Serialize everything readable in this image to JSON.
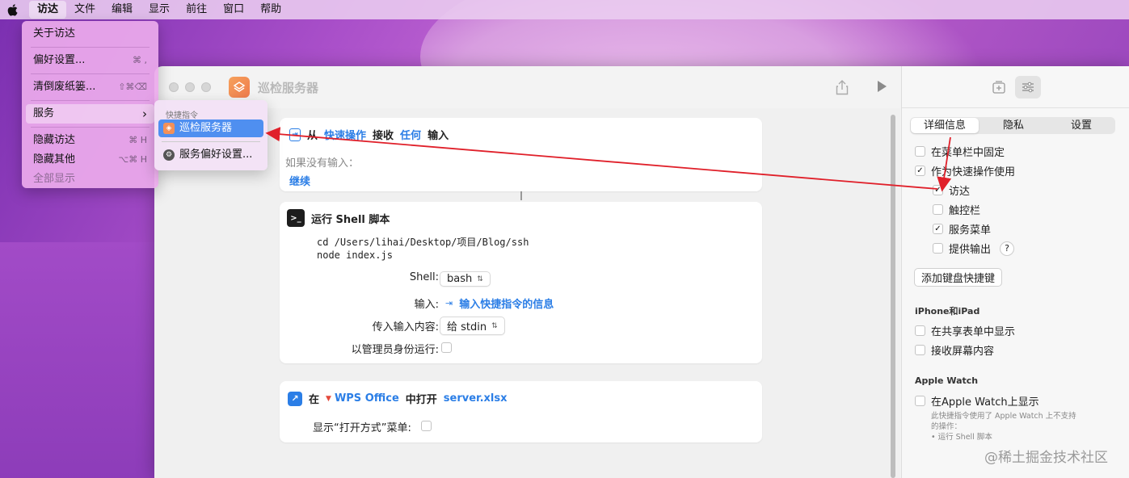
{
  "menubar": {
    "apple_icon": "apple-icon",
    "items": [
      "访达",
      "文件",
      "编辑",
      "显示",
      "前往",
      "窗口",
      "帮助"
    ],
    "active_index": 0
  },
  "finder_menu": {
    "about": "关于访达",
    "preferences": "偏好设置...",
    "preferences_shortcut": "⌘ ,",
    "empty_trash": "清倒废纸篓...",
    "empty_trash_shortcut": "⇧⌘⌫",
    "services": "服务",
    "services_chevron": "›",
    "hide_finder": "隐藏访达",
    "hide_finder_shortcut": "⌘ H",
    "hide_others": "隐藏其他",
    "hide_others_shortcut": "⌥⌘ H",
    "show_all": "全部显示"
  },
  "services_submenu": {
    "header": "快捷指令",
    "item": "巡检服务器",
    "prefs": "服务偏好设置..."
  },
  "window": {
    "title": "巡检服务器",
    "share_icon": "share-icon",
    "play_icon": "play-icon"
  },
  "action1": {
    "from": "从",
    "source": "快速操作",
    "receive": "接收",
    "any": "任何",
    "input": "输入",
    "if_no_input": "如果没有输入：",
    "continue": "继续"
  },
  "action2": {
    "title": "运行 Shell 脚本",
    "script": "cd /Users/lihai/Desktop/项目/Blog/ssh\nnode index.js",
    "shell_label": "Shell:",
    "shell_value": "bash",
    "input_label": "输入:",
    "input_value": "输入快捷指令的信息",
    "pass_label": "传入输入内容:",
    "pass_value": "给 stdin",
    "admin_label": "以管理员身份运行:"
  },
  "action3": {
    "in": "在",
    "app": "WPS Office",
    "open_in": "中打开",
    "file": "server.xlsx",
    "show_menu": "显示“打开方式”菜单:"
  },
  "inspector": {
    "tabs": [
      "详细信息",
      "隐私",
      "设置"
    ],
    "pin_menubar": "在菜单栏中固定",
    "use_quick_action": "作为快速操作使用",
    "finder": "访达",
    "touchbar": "触控栏",
    "services_menu": "服务菜单",
    "provide_output": "提供输出",
    "question": "?",
    "add_shortcut": "添加键盘快捷键",
    "iphone_ipad": "iPhone和iPad",
    "show_in_share": "在共享表单中显示",
    "receive_screen": "接收屏幕内容",
    "apple_watch": "Apple Watch",
    "show_on_watch": "在Apple Watch上显示",
    "watch_note": "此快捷指令使用了 Apple Watch 上不支持\n的操作：\n• 运行 Shell 脚本"
  },
  "watermark": "@稀土掘金技术社区",
  "colors": {
    "accent": "#2b7ee6",
    "selection": "#4f8ff0",
    "arrow": "#e0202a"
  }
}
